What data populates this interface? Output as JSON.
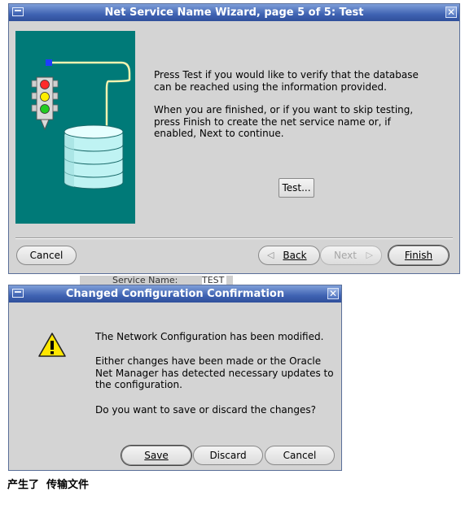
{
  "wizard": {
    "title": "Net Service Name Wizard, page 5 of 5: Test",
    "close_glyph": "✕",
    "paragraph1": "Press Test if you would like to verify that the database can be reached using the information provided.",
    "paragraph2": "When you are finished, or if you want to skip testing, press Finish to create the net service name or, if enabled, Next to continue.",
    "test_label": "Test...",
    "cancel_label": "Cancel",
    "back_label": "Back",
    "next_label": "Next",
    "finish_label": "Finish",
    "illustration_bg": "#007a78"
  },
  "behind_text": {
    "label": "Service Name:",
    "value": "TEST"
  },
  "confirm": {
    "title": "Changed Configuration Confirmation",
    "close_glyph": "✕",
    "message1": "The Network Configuration has been modified.",
    "message2": "Either changes have been made or the Oracle Net Manager has detected necessary updates to the configuration.",
    "message3": "Do you want to save or discard the changes?",
    "save_label": "Save",
    "discard_label": "Discard",
    "cancel_label": "Cancel",
    "warning_color": "#ffe600"
  },
  "caption": "产生了  传输文件"
}
